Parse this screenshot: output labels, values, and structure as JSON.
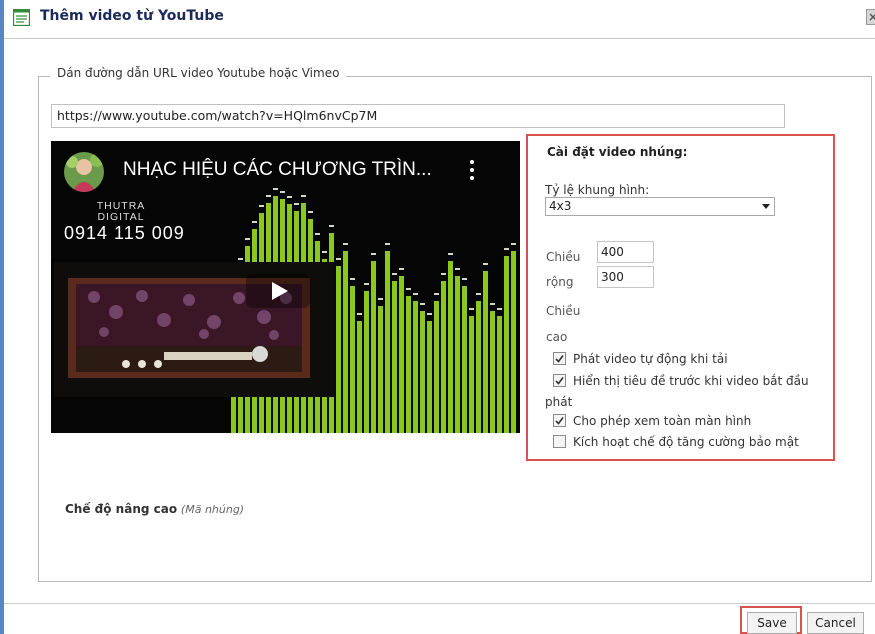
{
  "dialog": {
    "title": "Thêm video từ YouTube",
    "icon": "list-document-icon",
    "close_icon": "close-icon"
  },
  "url_section": {
    "legend": "Dán đường dẫn URL video Youtube hoặc Vimeo",
    "url_value": "https://www.youtube.com/watch?v=HQlm6nvCp7M"
  },
  "video_preview": {
    "title": "NHẠC HIỆU CÁC CHƯƠNG TRÌN...",
    "channel_line1": "THUTRA",
    "channel_line2": "DIGITAL",
    "phone": "0914 115 009",
    "bar_color": "#8bc81e"
  },
  "settings": {
    "title": "Cài đặt video nhúng:",
    "ratio_label": "Tỷ lệ khung hình:",
    "ratio_value": "4x3",
    "width_label_1": "Chiều",
    "width_label_2": "rộng",
    "height_label_1": "Chiều",
    "height_label_2": "cao",
    "width_value": "400",
    "height_value": "300",
    "options": [
      {
        "label": "Phát video tự động khi tải",
        "checked": true
      },
      {
        "label": "Hiển thị tiêu đề trước khi video bắt đầu",
        "label_cont": "phát",
        "checked": true
      },
      {
        "label": "Cho phép xem toàn màn hình",
        "checked": true
      },
      {
        "label": "Kích hoạt chế độ tăng cường bảo mật",
        "checked": false
      }
    ],
    "highlight_color": "#d9534f"
  },
  "advanced": {
    "label": "Chế độ nâng cao",
    "hint": "(Mã nhúng)"
  },
  "footer": {
    "save_label": "Save",
    "cancel_label": "Cancel"
  }
}
